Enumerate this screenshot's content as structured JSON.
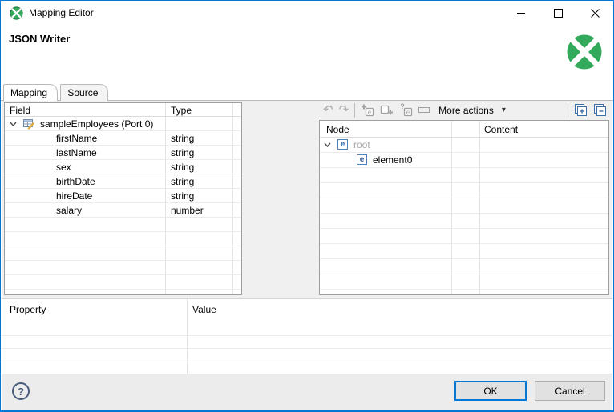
{
  "window": {
    "title": "Mapping Editor"
  },
  "header": {
    "title": "JSON Writer"
  },
  "tabs": {
    "mapping": "Mapping",
    "source": "Source"
  },
  "field_table": {
    "col_field": "Field",
    "col_type": "Type",
    "root_label": "sampleEmployees (Port 0)",
    "rows": [
      {
        "field": "firstName",
        "type": "string"
      },
      {
        "field": "lastName",
        "type": "string"
      },
      {
        "field": "sex",
        "type": "string"
      },
      {
        "field": "birthDate",
        "type": "string"
      },
      {
        "field": "hireDate",
        "type": "string"
      },
      {
        "field": "salary",
        "type": "number"
      }
    ]
  },
  "toolbar": {
    "more_actions": "More actions"
  },
  "node_table": {
    "col_node": "Node",
    "col_content": "Content",
    "rows": [
      {
        "label": "root"
      },
      {
        "label": "element0"
      }
    ]
  },
  "property_table": {
    "col_property": "Property",
    "col_value": "Value"
  },
  "footer": {
    "help": "?",
    "ok": "OK",
    "cancel": "Cancel"
  },
  "icons": {
    "element_letter": "e",
    "undo": "↶",
    "redo": "↷",
    "dropdown": "▾"
  },
  "colors": {
    "accent_blue": "#0078d7",
    "clover_green": "#33a95c",
    "element_blue": "#2a62a8",
    "toolbar_blue": "#3a6ea5"
  }
}
